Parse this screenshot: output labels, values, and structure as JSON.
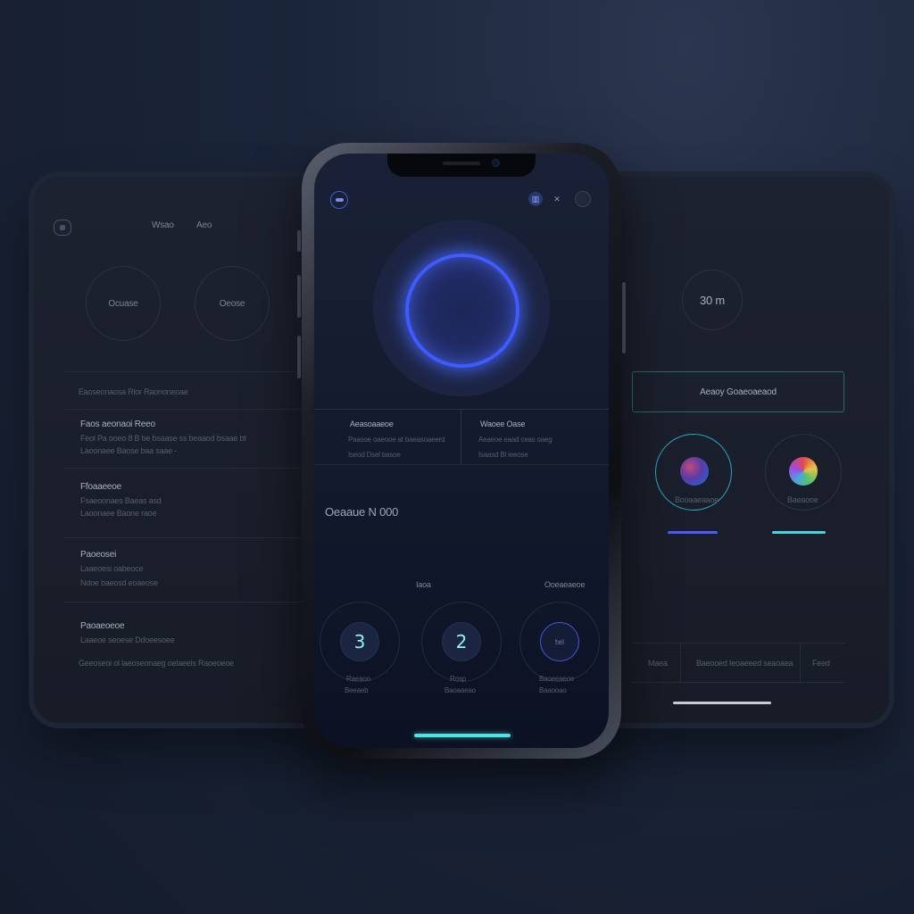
{
  "colors": {
    "background": "#1b2539",
    "accent_blue": "#3d5bff",
    "accent_cyan": "#4fe3e0",
    "panel": "#1b202c"
  },
  "left_panel": {
    "header_icon": "circle-icon",
    "header_labels": [
      "Wsao",
      "Aeo"
    ],
    "rings": [
      "Ocuase",
      "Oeose"
    ],
    "section_title": "Eaoseonaosa Rlor Raononeoae",
    "rows": [
      {
        "title": "Faos aeonaoi Reeo",
        "line1": "Feol Pa ooeo 8 B be bsaase ss beaaod bsaae bt",
        "line2": "Laoonaee Baose baa saae -"
      },
      {
        "title": "Ffoaaeeoe",
        "line1": "Fsaeoonaes Baeas asd",
        "line2": "Laoonaee Baone raoe"
      },
      {
        "title": "Paoeosei",
        "line1": "Laaeoesi oabeoce",
        "line2": "Ndoe baeosd eoaeose"
      },
      {
        "title": "Paoaeoeoe",
        "line1": "Laaeoe seoese Ddoeesoee",
        "line2": "Geeoseoi ol laeoseonaeg oelaeeis Raoeoeoe"
      }
    ]
  },
  "phone": {
    "status_left_icon": "menu-pill-icon",
    "status_right_icons": [
      "grid-icon",
      "close-icon",
      "profile-icon"
    ],
    "status_right_glyphs": [
      "▥",
      "✕",
      ""
    ],
    "columns": [
      {
        "title": "Aeasoaaeoe",
        "line1": "Paasoe oaeooe at baeasoaeerd",
        "line2": "Iseod Dsel basoe"
      },
      {
        "title": "Waoee Oase",
        "line1": "Aeaeoe eaad ceas oaeg",
        "line2": "Isaasd Bl ieeose"
      }
    ],
    "device_label": "Oeaaue N 000",
    "small_labels": [
      "Iaoa",
      "Ooeaeaeoe"
    ],
    "counters": [
      {
        "value": "3",
        "label1": "Raeaoo",
        "label2": "Beeaeb"
      },
      {
        "value": "2",
        "label1": "Rosp",
        "label2": "Baoaaeao"
      },
      {
        "value": "tel",
        "label1": "Baoeeaeoe",
        "label2": "Baaooao"
      }
    ]
  },
  "right_panel": {
    "timer": "30 m",
    "button_label": "Aeaoy Goaeoaeaod",
    "orbs": [
      {
        "label": "Booaaeaaoe",
        "bar_color": "#4a5bff"
      },
      {
        "label": "Baeaooe",
        "bar_color": "#3fd6e0"
      }
    ],
    "footer_items": [
      "Maea",
      "Baeooed Ieoaeeed seaoaea",
      "Feed"
    ]
  }
}
